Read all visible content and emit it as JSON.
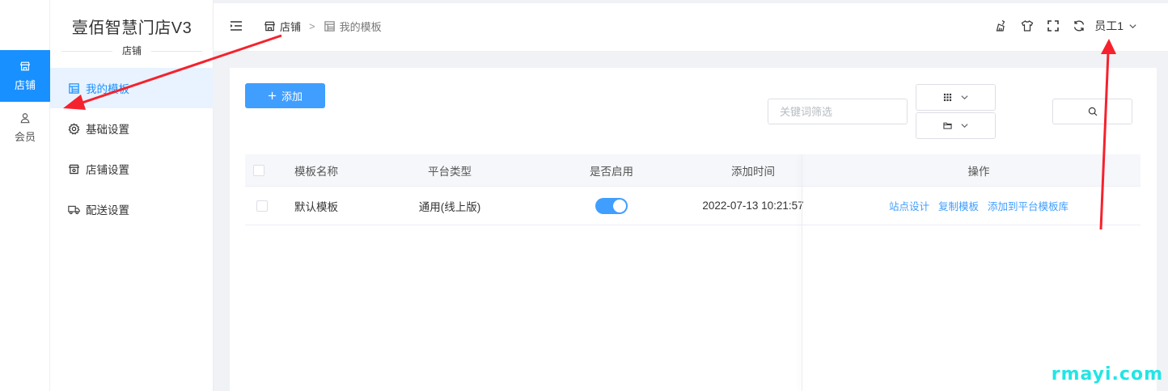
{
  "rail": {
    "items": [
      {
        "label": "店铺",
        "icon": "store-icon",
        "active": true
      },
      {
        "label": "会员",
        "icon": "user-icon",
        "active": false
      }
    ]
  },
  "sidebar": {
    "brand": "壹佰智慧门店V3",
    "section": "店铺",
    "items": [
      {
        "label": "我的模板",
        "icon": "template-icon",
        "active": true
      },
      {
        "label": "基础设置",
        "icon": "gear-icon",
        "active": false
      },
      {
        "label": "店铺设置",
        "icon": "store-settings-icon",
        "active": false
      },
      {
        "label": "配送设置",
        "icon": "truck-icon",
        "active": false
      }
    ]
  },
  "header": {
    "breadcrumb": [
      "店铺",
      "我的模板"
    ],
    "separator": ">",
    "user": "员工1"
  },
  "toolbar": {
    "add_label": "添加",
    "filter_placeholder": "关键词筛选"
  },
  "table": {
    "columns": [
      "模板名称",
      "平台类型",
      "是否启用",
      "添加时间",
      "操作"
    ],
    "rows": [
      {
        "name": "默认模板",
        "platform": "通用(线上版)",
        "enabled": true,
        "added": "2022-07-13 10:21:57",
        "actions": [
          "站点设计",
          "复制模板",
          "添加到平台模板库"
        ]
      }
    ]
  },
  "watermark": "rmayi.com",
  "colors": {
    "primary": "#409eff",
    "rail_active": "#1890ff",
    "annotation": "#f5222d",
    "watermark": "#22e5e5"
  }
}
